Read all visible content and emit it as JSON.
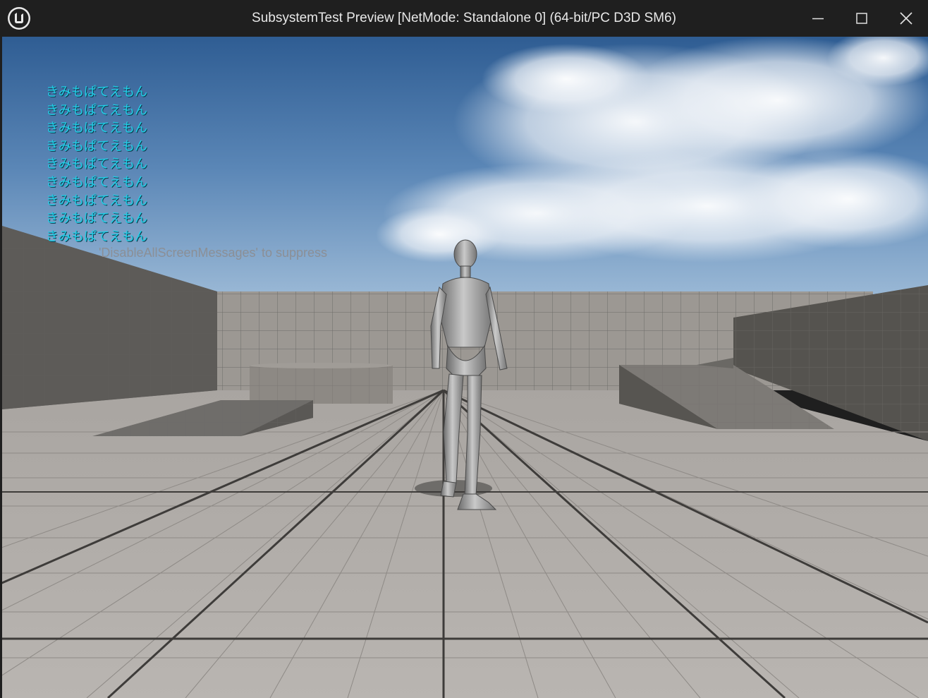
{
  "window": {
    "title": "SubsystemTest Preview [NetMode: Standalone 0]  (64-bit/PC D3D SM6)",
    "logo_icon": "unreal-engine-logo-icon",
    "controls": [
      "minimize-icon",
      "maximize-icon",
      "close-icon"
    ]
  },
  "viewport": {
    "screen_messages": [
      "きみもぱてえもん",
      "きみもぱてえもん",
      "きみもぱてえもん",
      "きみもぱてえもん",
      "きみもぱてえもん",
      "きみもぱてえもん",
      "きみもぱてえもん",
      "きみもぱてえもん",
      "きみもぱてえもん"
    ],
    "suppress_hint": "'DisableAllScreenMessages' to suppress",
    "message_color": "#21cfe8"
  }
}
